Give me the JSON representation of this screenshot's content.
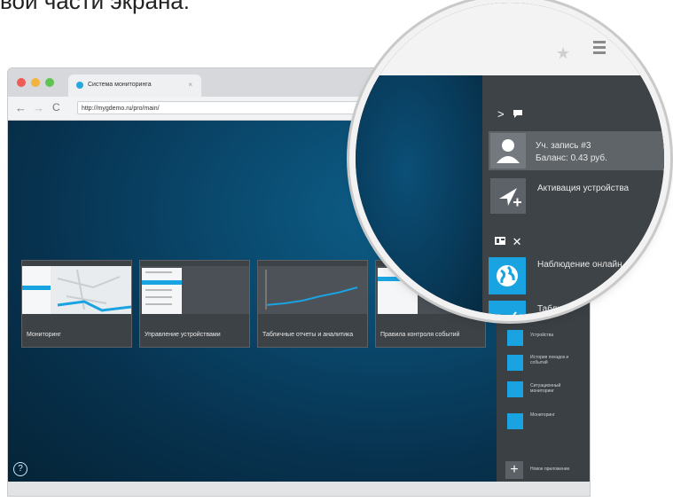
{
  "caption": "вой части экрана:",
  "browser": {
    "tab_title": "Система мониторинга",
    "tab_close": "×",
    "url": "http://mygdemo.ru/pro/main/",
    "nav_back": "←",
    "nav_forward": "→",
    "nav_reload": "C"
  },
  "tiles": [
    {
      "label": "Мониторинг"
    },
    {
      "label": "Управление устройствами"
    },
    {
      "label": "Табличные отчеты и аналитика"
    },
    {
      "label": "Правила контроля событий"
    }
  ],
  "help_icon": "?",
  "sidebar_small": {
    "items": [
      {
        "label": "Устройства"
      },
      {
        "label": "История поездок и событий"
      },
      {
        "label": "Ситуационный мониторинг"
      },
      {
        "label": "Мониторинг"
      }
    ],
    "add_label": "Новое приложение",
    "add_icon": "+"
  },
  "magnifier": {
    "chevron": ">",
    "account_name": "Уч. запись #3",
    "balance_label": "Баланс: 0.43 руб.",
    "activate_label": "Активация устройства",
    "apps": [
      {
        "label": "Наблюдение онлайн",
        "icon": "globe-icon"
      },
      {
        "label": "Табличные отчеты и аналитика",
        "icon": "chart-icon"
      }
    ]
  },
  "colors": {
    "accent": "#1aa3e1",
    "sidebar": "#3b4044",
    "viewport": "#0a4a6f"
  }
}
